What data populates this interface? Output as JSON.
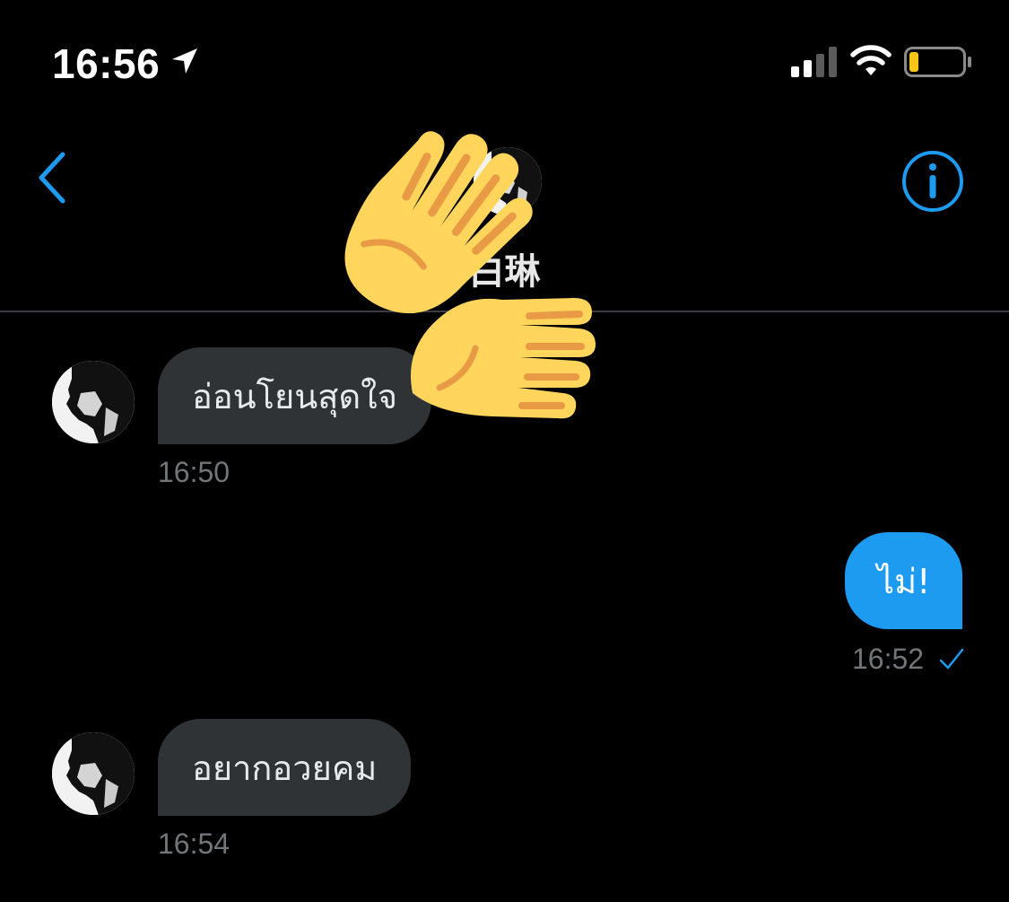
{
  "status_bar": {
    "time": "16:56",
    "icons": [
      "location-arrow-icon",
      "cellular-signal-icon",
      "wifi-icon",
      "battery-low-icon"
    ]
  },
  "header": {
    "contact_name": "白琳",
    "back_icon": "chevron-left-icon",
    "info_icon": "info-circle-icon"
  },
  "colors": {
    "accent": "#1d9bf0",
    "incoming_bubble": "#2f3336",
    "timestamp": "#71767b",
    "background": "#000000",
    "battery_level": "#f5c518"
  },
  "messages": [
    {
      "direction": "incoming",
      "text": "อ่อนโยนสุดใจ",
      "time": "16:50"
    },
    {
      "direction": "outgoing",
      "text": "ไม่!",
      "time": "16:52",
      "status_icon": "read-check-icon"
    },
    {
      "direction": "incoming",
      "text": "อยากอวยคม",
      "time": "16:54"
    }
  ],
  "overlay_emoji": "raising-hands-emoji"
}
